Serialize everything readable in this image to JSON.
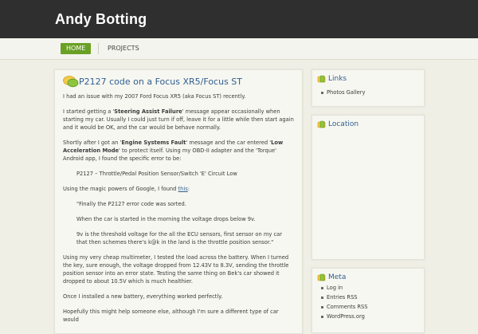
{
  "site": {
    "title": "Andy Botting"
  },
  "nav": {
    "home": "HOME",
    "projects": "PROJECTS"
  },
  "post": {
    "title": "P2127 code on a Focus XR5/Focus ST",
    "p1": "I had an issue with my 2007 Ford Focus XR5 (aka Focus ST) recently.",
    "p2_a": "I started getting a '",
    "p2_b": "Steering Assist Failure",
    "p2_c": "' message appear occasionally when starting my car. Usually I could just turn if off, leave it for a little while then start again and it would be OK, and the car would be behave normally.",
    "p3_a": "Shortly after I got an '",
    "p3_b": "Engine Systems Fault",
    "p3_c": "' message and the car entered '",
    "p3_d": "Low Acceleration Mode",
    "p3_e": "' to protect itself. Using my OBD-II adapter and the 'Torque' Android app, I found the specific error to be:",
    "code": "P2127 – Throttle/Pedal Position Sensor/Switch 'E' Circuit Low",
    "p4_a": "Using the magic powers of Google, I found ",
    "p4_link": "this",
    "p4_b": ":",
    "q1": "\"Finally the P2127 error code was sorted.",
    "q2": "When the car is started in the morning the voltage drops below 9v.",
    "q3": "9v is the threshold voltage for the all the ECU sensors, first sensor on my car that then schemes there's k@k in the land is the throttle position sensor.\"",
    "p5": "Using my very cheap multimeter, I tested the load across the battery. When I turned the key, sure enough, the voltage dropped from 12.43V to 8.3V, sending the throttle position sensor into an error state. Testing the same thing on Bek's car showed it dropped to about 10.5V which is much healthier.",
    "p6": "Once I installed a new battery, everything worked perfectly.",
    "p7": "Hopefully this might help someone else, although I'm sure a different type of car would"
  },
  "sidebar": {
    "links": {
      "title": "Links",
      "items": [
        "Photos Gallery"
      ]
    },
    "location": {
      "title": "Location"
    },
    "meta": {
      "title": "Meta",
      "items": [
        "Log in",
        "Entries RSS",
        "Comments RSS",
        "WordPress.org"
      ]
    }
  },
  "colors": {
    "accent": "#6aa024",
    "link": "#2f5f91",
    "header": "#2f2f2f"
  }
}
